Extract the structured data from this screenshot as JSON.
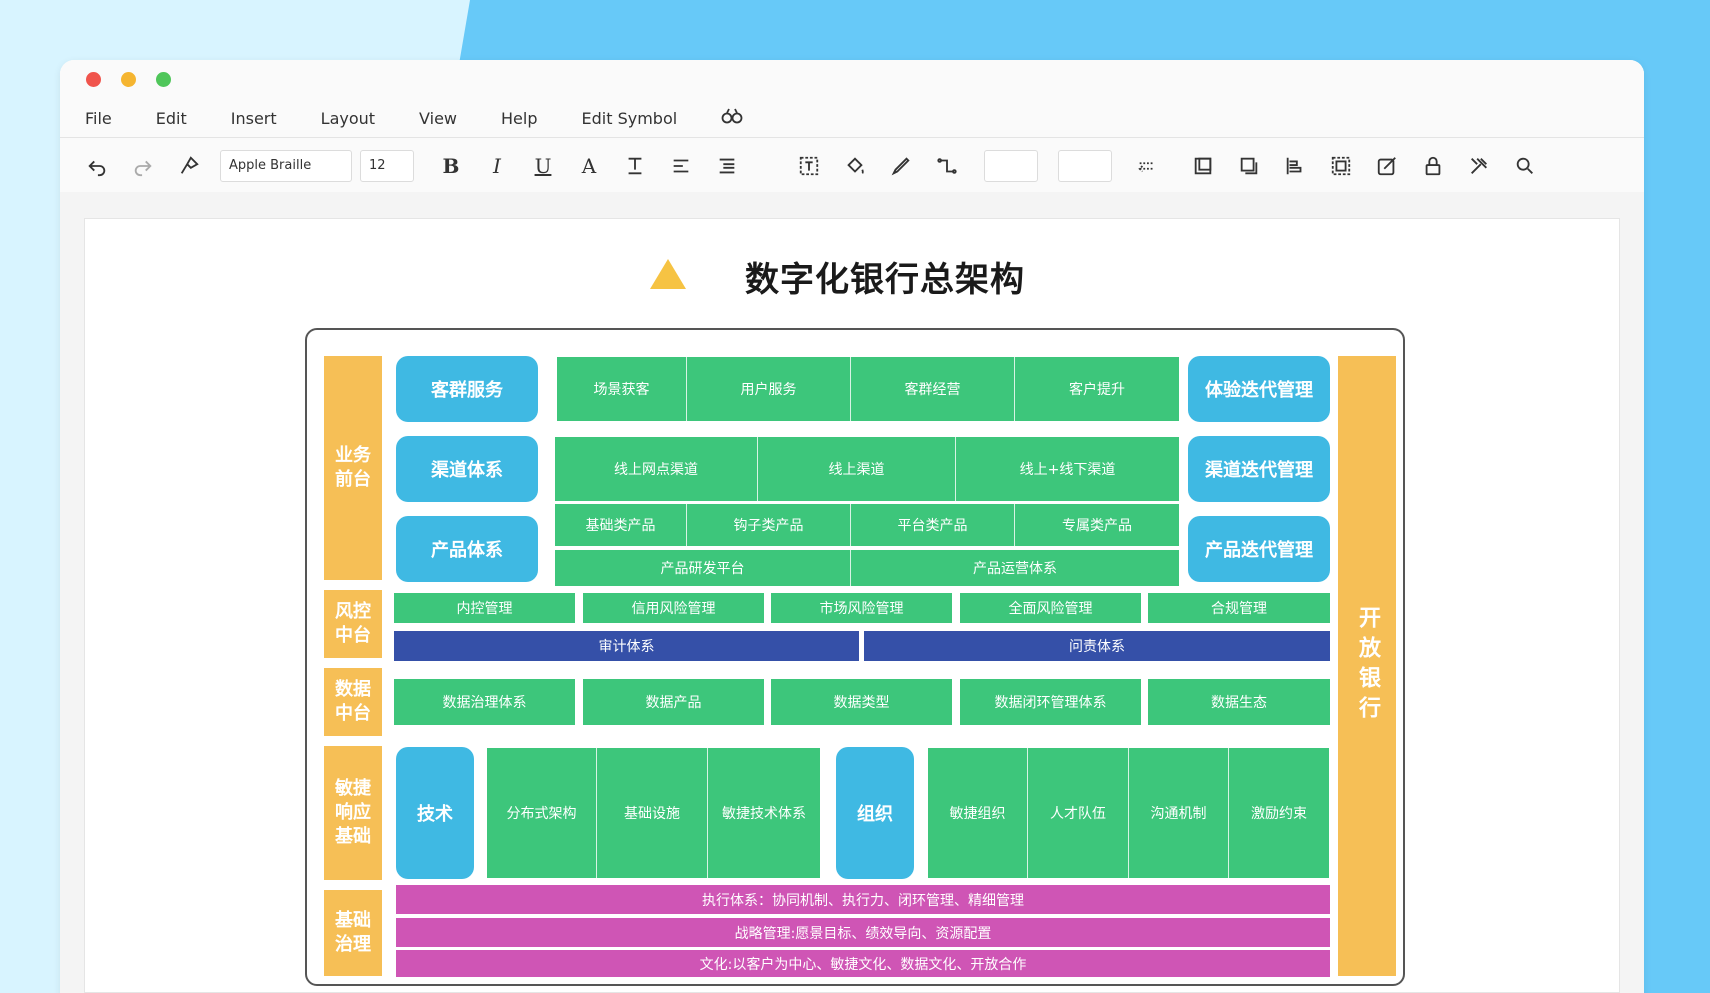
{
  "window": {
    "menu": [
      "File",
      "Edit",
      "Insert",
      "Layout",
      "View",
      "Help",
      "Edit Symbol"
    ],
    "menu_extra_icon": "binoculars-icon"
  },
  "toolbar": {
    "font_family": "Apple Braille",
    "font_size": "12",
    "bold": "B",
    "italic": "I",
    "underline": "U",
    "font_color": "A"
  },
  "diagram": {
    "title": "数字化银行总架构",
    "layers": {
      "front": "业务\n前台",
      "risk": "风控\n中台",
      "data": "数据\n中台",
      "agile": "敏捷\n响应\n基础",
      "gov": "基础\n治理"
    },
    "open_bank": "开放银行",
    "front": {
      "caps_left": [
        "客群服务",
        "渠道体系",
        "产品体系"
      ],
      "caps_right": [
        "体验迭代管理",
        "渠道迭代管理",
        "产品迭代管理"
      ],
      "row1": [
        "场景获客",
        "用户服务",
        "客群经营",
        "客户提升"
      ],
      "row2": [
        "线上网点渠道",
        "线上渠道",
        "线上+线下渠道"
      ],
      "row3": [
        "基础类产品",
        "钩子类产品",
        "平台类产品",
        "专属类产品"
      ],
      "row4": [
        "产品研发平台",
        "产品运营体系"
      ]
    },
    "risk": {
      "row1": [
        "内控管理",
        "信用风险管理",
        "市场风险管理",
        "全面风险管理",
        "合规管理"
      ],
      "row2": [
        "审计体系",
        "问责体系"
      ]
    },
    "data": {
      "row": [
        "数据治理体系",
        "数据产品",
        "数据类型",
        "数据闭环管理体系",
        "数据生态"
      ]
    },
    "agile": {
      "tech": "技术",
      "tech_items": [
        "分布式架构",
        "基础设施",
        "敏捷技术体系"
      ],
      "org": "组织",
      "org_items": [
        "敏捷组织",
        "人才队伍",
        "沟通机制",
        "激励约束"
      ]
    },
    "gov": {
      "rows": [
        "执行体系：协同机制、执行力、闭环管理、精细管理",
        "战略管理:愿景目标、绩效导向、资源配置",
        "文化:以客户为中心、敏捷文化、数据文化、开放合作"
      ]
    }
  },
  "colors": {
    "orange": "#f6bf56",
    "blue": "#3fb9e3",
    "green": "#3dc67b",
    "navy": "#3550a8",
    "pink": "#cf55b5"
  }
}
